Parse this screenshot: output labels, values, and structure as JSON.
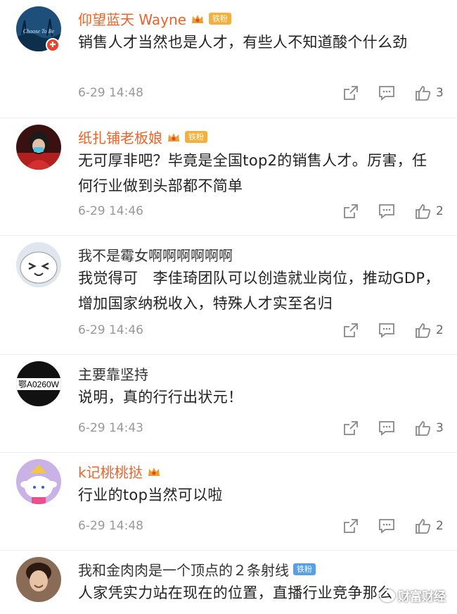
{
  "colors": {
    "vip_name": "#e8642c",
    "plain_name": "#333333",
    "time": "#999999",
    "fan_badge": "#f4b03e",
    "fan_badge_blue": "#5a9fe2"
  },
  "comments": [
    {
      "user": "仰望蓝天 Wayne",
      "name_style": "vip",
      "badge": "铁粉",
      "has_crown": true,
      "verified": true,
      "avatar_caption": "Choose To Be",
      "text": "销售人才当然也是人才，有些人不知道酸个什么劲",
      "time": "6-29 14:48",
      "likes": "3"
    },
    {
      "user": "纸扎铺老板娘",
      "name_style": "vip",
      "badge": "铁粉",
      "has_crown": true,
      "verified": false,
      "text": "无可厚非吧？毕竟是全国top2的销售人才。厉害，任何行业做到头部都不简单",
      "time": "6-29 14:46",
      "likes": "2"
    },
    {
      "user": "我不是霉女啊啊啊啊啊啊",
      "name_style": "plain",
      "badge": "",
      "has_crown": false,
      "verified": false,
      "text": "我觉得可　李佳琦团队可以创造就业岗位，推动GDP，增加国家纳税收入，特殊人才实至名归",
      "time": "6-29 14:46",
      "likes": "2"
    },
    {
      "user": "主要靠坚持",
      "name_style": "plain",
      "badge": "",
      "has_crown": false,
      "verified": false,
      "avatar_caption": "鄂A0260W",
      "text": "说明，真的行行出状元！",
      "time": "6-29 14:43",
      "likes": "3"
    },
    {
      "user": "k记桃桃挞",
      "name_style": "vip",
      "badge": "",
      "has_crown": true,
      "verified": false,
      "text": "行业的top当然可以啦",
      "time": "6-29 14:48",
      "likes": "2"
    },
    {
      "user": "我和金肉肉是一个顶点的２条射线",
      "name_style": "plain",
      "badge": "铁粉",
      "badge_color": "blue",
      "has_crown": false,
      "verified": false,
      "text": "人家凭实力站在现在的位置，直播行业竞争那么",
      "time": "",
      "likes": ""
    }
  ],
  "watermark": "财富财经",
  "icons": {
    "share": "share-icon",
    "comment": "comment-icon",
    "like": "thumbs-up-icon"
  }
}
